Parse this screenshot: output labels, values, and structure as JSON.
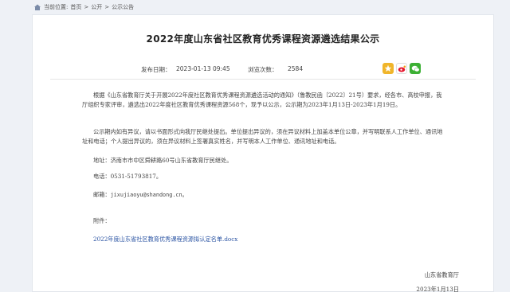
{
  "breadcrumb": {
    "prefix": "当前位置:",
    "items": [
      "首页",
      "公开",
      "公示公告"
    ],
    "separator": ">"
  },
  "article": {
    "title": "2022年度山东省社区教育优秀课程资源遴选结果公示",
    "publish_label": "发布日期：",
    "publish_date": "2023-01-13 09:45",
    "views_label": "浏览次数：",
    "views": "2584",
    "share_icons": [
      "star-share-icon",
      "weibo-share-icon",
      "wechat-share-icon"
    ],
    "paragraph1": "根据《山东省教育厅关于开展2022年度社区教育优秀课程资源遴选活动的通知》（鲁教民函〔2022〕21号）要求，经各市、高校申报，我厅组织专家评审，遴选出2022年度社区教育优秀课程资源568个，现予以公示，公示期为2023年1月13日-2023年1月19日。",
    "paragraph2": "公示期内如有异议，请以书面形式向我厅民继处提出。单位提出异议的，须在异议材料上加盖本单位公章，并写明联系人工作单位、通讯地址和电话；个人提出异议的，须在异议材料上签署真实姓名，并写明本人工作单位、通讯地址和电话。",
    "address": "地址：济南市市中区舜耕路60号山东省教育厅民继处。",
    "phone": "电话：0531-51793817。",
    "email_label": "邮箱：",
    "email": "jixujiaoyu@shandong.cn。",
    "attachment_label": "附件：",
    "attachment_link": "2022年度山东省社区教育优秀课程资源拟认定名单.docx",
    "signature": "山东省教育厅",
    "sign_date": "2023年1月13日"
  },
  "colors": {
    "link": "#2b54a3",
    "background": "#eef1f6"
  }
}
